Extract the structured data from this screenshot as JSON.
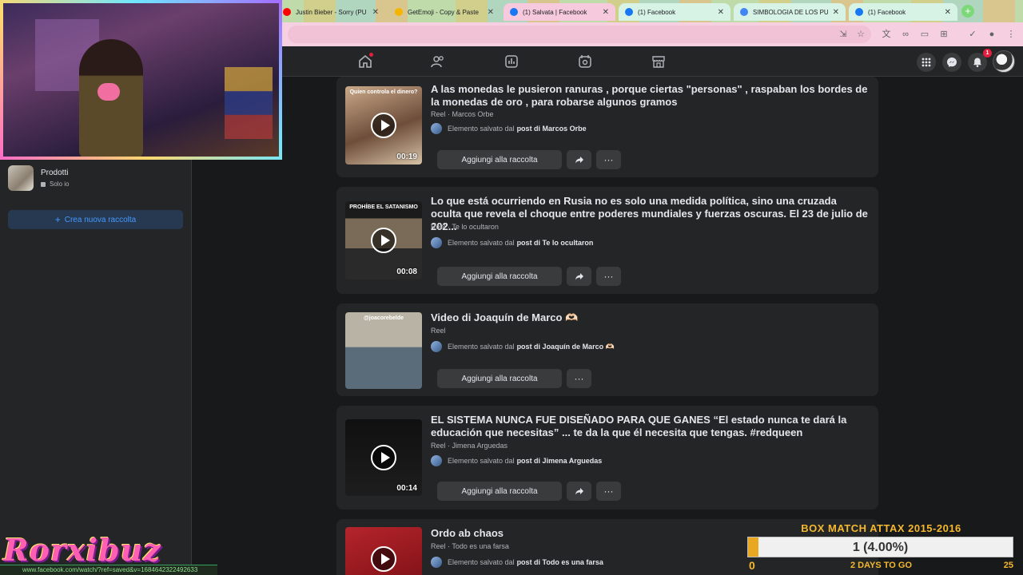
{
  "browser": {
    "tabs": [
      {
        "title": "Justin Bieber - Sorry (PU",
        "color": "#ff0000"
      },
      {
        "title": "GetEmoji - Copy & Paste",
        "color": "#f4b400"
      },
      {
        "title": "(1) Salvata | Facebook",
        "color": "#1877f2"
      },
      {
        "title": "(1) Facebook",
        "color": "#1877f2"
      },
      {
        "title": "SIMBOLOGIA DE LOS PU",
        "color": "#4285f4"
      },
      {
        "title": "(1) Facebook",
        "color": "#1877f2"
      }
    ],
    "new_tab_symbol": "+"
  },
  "fbnav": {
    "notification_count": "1",
    "icons": [
      "home-icon",
      "friends-icon",
      "feeds-icon",
      "groups-icon",
      "marketplace-icon",
      "menu-grid-icon",
      "messenger-icon",
      "bell-icon"
    ]
  },
  "sidebar": {
    "collection": {
      "name": "Prodotti",
      "privacy": "Solo io"
    },
    "new_collection_label": "Crea nuova raccolta"
  },
  "saved_items": [
    {
      "title": "A las monedas le pusieron ranuras , porque ciertas \"personas\" , raspaban los bordes de la monedas de oro , para robarse algunos gramos",
      "type": "Reel",
      "author": "Marcos Orbe",
      "saved_prefix": "Elemento salvato dal",
      "saved_from": "post di Marcos Orbe",
      "duration": "00:19",
      "thumb_text": "Quien controla el dinero?"
    },
    {
      "title": "Lo que está ocurriendo en Rusia no es solo una medida política, sino una cruzada oculta que revela el choque entre poderes mundiales y fuerzas oscuras. El 23 de julio de 202...",
      "type": "Reel",
      "author": "Te lo ocultaron",
      "saved_prefix": "Elemento salvato dal",
      "saved_from": "post di Te lo ocultaron",
      "duration": "00:08",
      "thumb_text": "PROHÍBE EL SATANISMO"
    },
    {
      "title": "Video di Joaquín de Marco 🫶🏻",
      "type": "Reel",
      "author": "",
      "saved_prefix": "Elemento salvato dal",
      "saved_from": "post di Joaquín de Marco 🫶🏻",
      "duration": "",
      "thumb_text": "@joacorebelde"
    },
    {
      "title": "EL SISTEMA NUNCA FUE DISEÑADO PARA QUE GANES “El estado nunca te dará la educación que necesitas” ... te da la que él necesita que tengas. #redqueen",
      "type": "Reel",
      "author": "Jimena Arguedas",
      "saved_prefix": "Elemento salvato dal",
      "saved_from": "post di Jimena Arguedas",
      "duration": "00:14",
      "thumb_text": ""
    },
    {
      "title": "Ordo ab chaos",
      "type": "Reel",
      "author": "Todo es una farsa",
      "saved_prefix": "Elemento salvato dal",
      "saved_from": "post di Todo es una farsa",
      "duration": "",
      "thumb_text": ""
    }
  ],
  "actions": {
    "add_to_collection": "Aggiungi alla raccolta",
    "more": "···"
  },
  "meta_separator": " · ",
  "stream": {
    "channel_logo": "Rorxibuz",
    "status_url": "www.facebook.com/watch/?ref=saved&v=1684642322492633",
    "goal_title": "BOX MATCH ATTAX 2015-2016",
    "goal_value": "1 (4.00%)",
    "goal_progress": 0.04,
    "goal_min": "0",
    "goal_days": "2 DAYS TO GO",
    "goal_max": "25"
  }
}
